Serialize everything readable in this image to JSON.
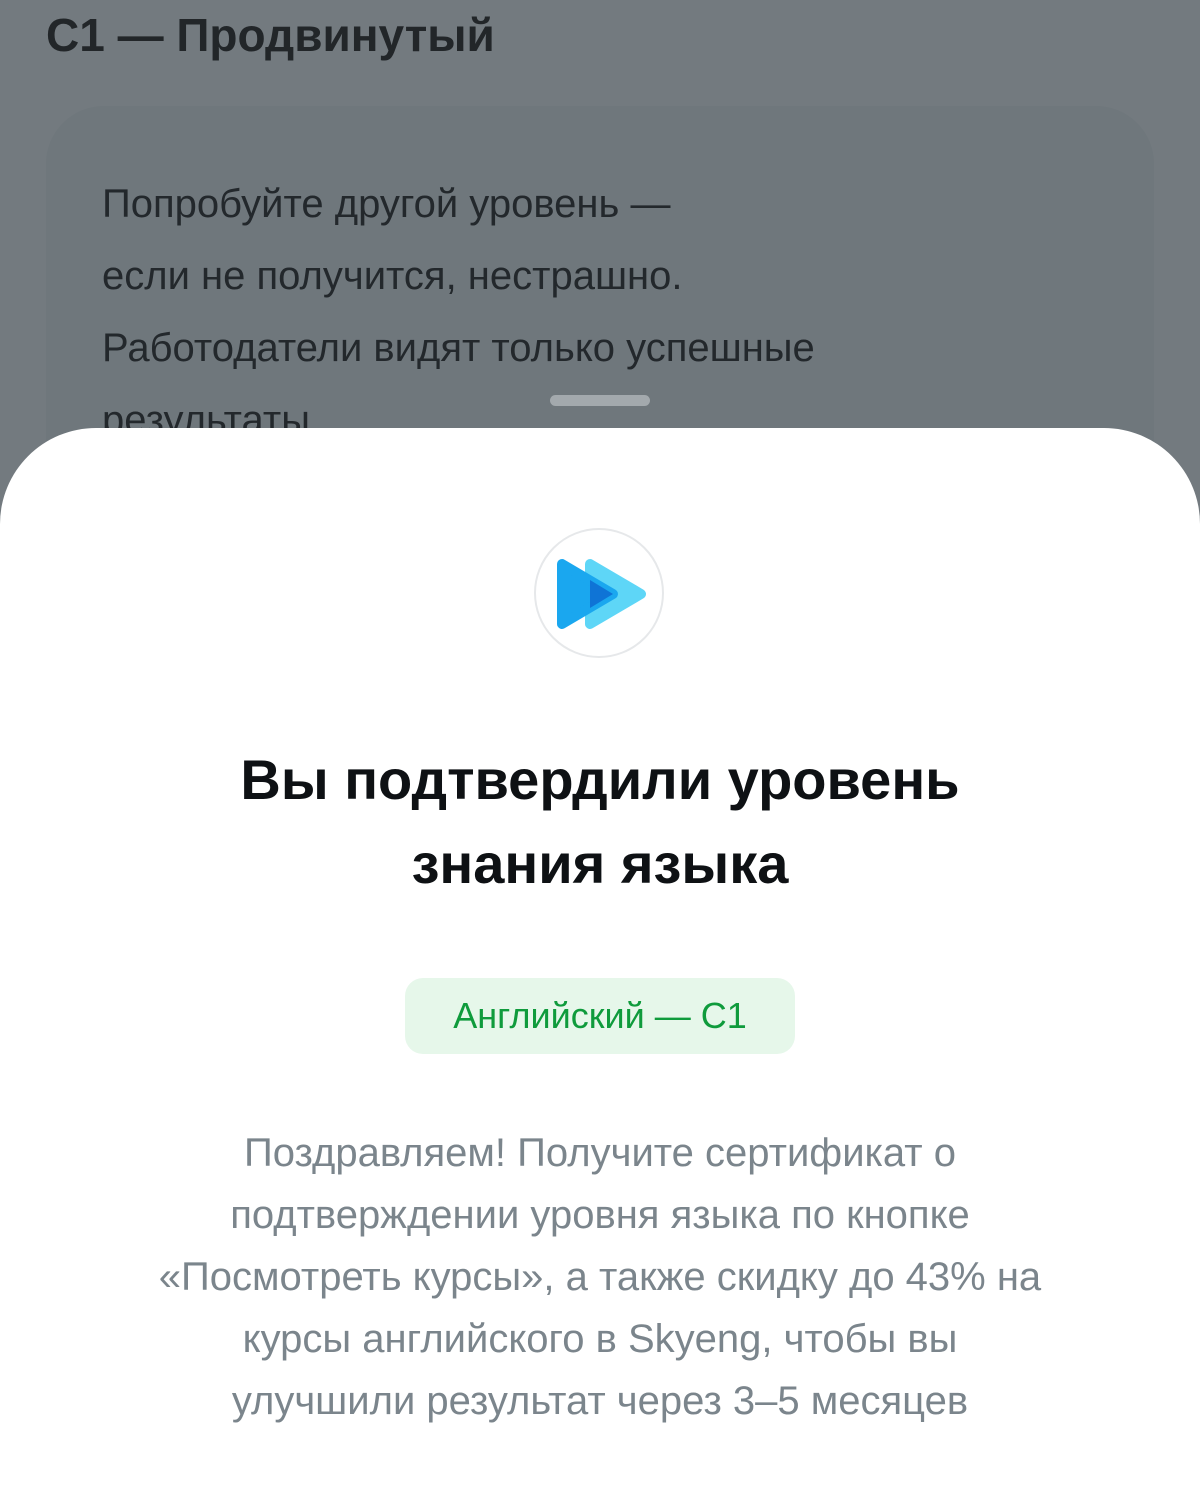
{
  "background": {
    "heading": "C1 — Продвинутый",
    "card_lines": [
      "Попробуйте другой уровень —",
      "если не получится, нестрашно.",
      "Работодатели видят только успешные",
      "результаты"
    ]
  },
  "sheet": {
    "logo_icon": "skyeng-play-icon",
    "title_lines": [
      "Вы подтвердили уровень",
      "знания языка"
    ],
    "badge": "Английский — C1",
    "description_lines": [
      "Поздравляем! Получите сертификат о",
      "подтверждении уровня языка по кнопке",
      "«Посмотреть курсы», а также скидку до 43% на",
      "курсы английского в Skyeng, чтобы вы",
      "улучшили результат через 3–5 месяцев"
    ]
  },
  "colors": {
    "backdrop": "#737a7f",
    "badge_bg": "#e6f7ea",
    "badge_text": "#0f9b3c",
    "logo_blue": "#1aa7ef",
    "logo_light": "#5ed6f7"
  }
}
